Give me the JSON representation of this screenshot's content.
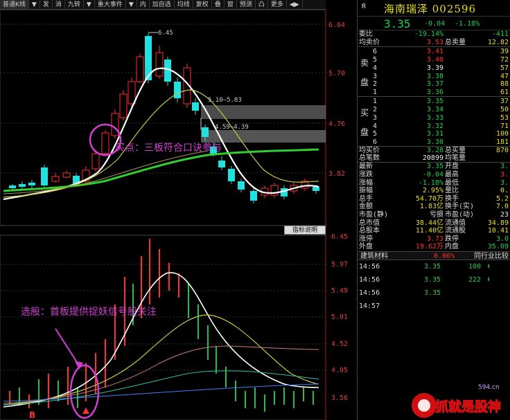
{
  "toolbar": {
    "items": [
      "普通K线",
      "▼",
      "发",
      "消",
      "九转",
      "▼",
      "重大事件",
      "▼",
      "内",
      "加自选",
      "均线",
      "复权",
      "叠",
      "窗",
      "预测",
      "凸",
      "更多",
      "◀▶"
    ]
  },
  "main_price_axis": [
    "6.64",
    "5.70",
    "4.76",
    "3.82"
  ],
  "sub_price_axis": [
    "6.45",
    "5.97",
    "5.49",
    "5.01",
    "4.52",
    "4.05",
    "3.56"
  ],
  "annotations": {
    "high_label": "6.45",
    "gap1_label": "5.10–5.83",
    "gap2_label": "4.59–4.39",
    "buy_note": "买点：三板符合口诀参与",
    "select_note": "选股：首板提供捉妖信号股关注",
    "b_marker": "B"
  },
  "indicator_button": "指标说明",
  "quote": {
    "r": "R",
    "name": "海南瑞泽 002596",
    "price": "3.35",
    "change": "-0.04",
    "pct": "-1.18%",
    "ratio_label": "委比",
    "ratio_value": "-19.14%",
    "ratio_diff": "-411",
    "avg_sell_label": "均卖价",
    "avg_sell": "3.53",
    "total_sell_label": "总卖量",
    "total_sell": "12.82",
    "sell_side_label": [
      "卖",
      "盘"
    ],
    "buy_side_label": [
      "买",
      "盘"
    ],
    "sells": [
      {
        "lvl": "6",
        "price": "3.41",
        "vol": "39"
      },
      {
        "lvl": "5",
        "price": "3.40",
        "vol": "72"
      },
      {
        "lvl": "4",
        "price": "3.39",
        "vol": "57"
      },
      {
        "lvl": "3",
        "price": "3.38",
        "vol": "47"
      },
      {
        "lvl": "2",
        "price": "3.37",
        "vol": "88"
      },
      {
        "lvl": "1",
        "price": "3.36",
        "vol": "61"
      }
    ],
    "buys": [
      {
        "lvl": "1",
        "price": "3.35",
        "vol": "37"
      },
      {
        "lvl": "2",
        "price": "3.34",
        "vol": "50"
      },
      {
        "lvl": "3",
        "price": "3.33",
        "vol": "53"
      },
      {
        "lvl": "4",
        "price": "3.32",
        "vol": "71"
      },
      {
        "lvl": "5",
        "price": "3.31",
        "vol": "100"
      },
      {
        "lvl": "6",
        "price": "3.30",
        "vol": "181"
      }
    ],
    "avg_buy_label": "均买价",
    "avg_buy": "3.28",
    "total_buy_label": "总买量",
    "total_buy": "870",
    "total_trades_label": "总笔数",
    "total_trades": "20899",
    "avg_trade_label": "均笔量",
    "stats": [
      {
        "l1": "最新",
        "v1": "3.35",
        "c1": "grn",
        "l2": "开盘",
        "v2": "3.",
        "c2": "grn"
      },
      {
        "l1": "涨跌",
        "v1": "-0.04",
        "c1": "grn",
        "l2": "最高",
        "v2": "3.",
        "c2": "red"
      },
      {
        "l1": "涨幅",
        "v1": "-1.18%",
        "c1": "grn",
        "l2": "最低",
        "v2": "3.",
        "c2": "grn"
      },
      {
        "l1": "振幅",
        "v1": "2.95%",
        "c1": "ylw",
        "l2": "量比",
        "v2": "0.",
        "c2": "ylw"
      },
      {
        "l1": "总手",
        "v1": "54.70万",
        "c1": "ylw",
        "l2": "换手",
        "v2": "5.2",
        "c2": "ylw"
      },
      {
        "l1": "金额",
        "v1": "1.83亿",
        "c1": "ylw",
        "l2": "换手(实)",
        "v2": "7.0",
        "c2": "ylw"
      },
      {
        "l1": "市盈(静)",
        "v1": "亏损",
        "c1": "wht",
        "l2": "市盈(动)",
        "v2": "23",
        "c2": "wht"
      },
      {
        "l1": "总市值",
        "v1": "38.44亿",
        "c1": "ylw",
        "l2": "流通值",
        "v2": "34.89",
        "c2": "ylw"
      },
      {
        "l1": "总股本",
        "v1": "11.40亿",
        "c1": "ylw",
        "l2": "流通股",
        "v2": "10.41",
        "c2": "ylw"
      },
      {
        "l1": "涨停",
        "v1": "3.73",
        "c1": "red",
        "l2": "跌停",
        "v2": "3.0",
        "c2": "grn"
      },
      {
        "l1": "外盘",
        "v1": "19.62万",
        "c1": "red",
        "l2": "内盘",
        "v2": "35.09",
        "c2": "grn"
      }
    ],
    "industry_name": "建筑材料",
    "industry_pct": "0.06%",
    "industry_link": "同行业比较",
    "ticks": [
      {
        "t": "14:56",
        "p": "3.35",
        "vol": "100"
      },
      {
        "t": "14:56",
        "p": "3.35",
        "vol": "222"
      },
      {
        "t": "14:56",
        "p": "3.35",
        "vol": ""
      },
      {
        "t": "14:57",
        "p": "",
        "vol": ""
      }
    ]
  },
  "watermark": {
    "text": "抓就是股神",
    "site": "594.cn"
  },
  "colors": {
    "up": "#ff3030",
    "down": "#20e0e0",
    "ma_white": "#ffffff",
    "ma_yellow": "#c8c840",
    "ma_green": "#30d030",
    "annotation": "#d040d0"
  }
}
